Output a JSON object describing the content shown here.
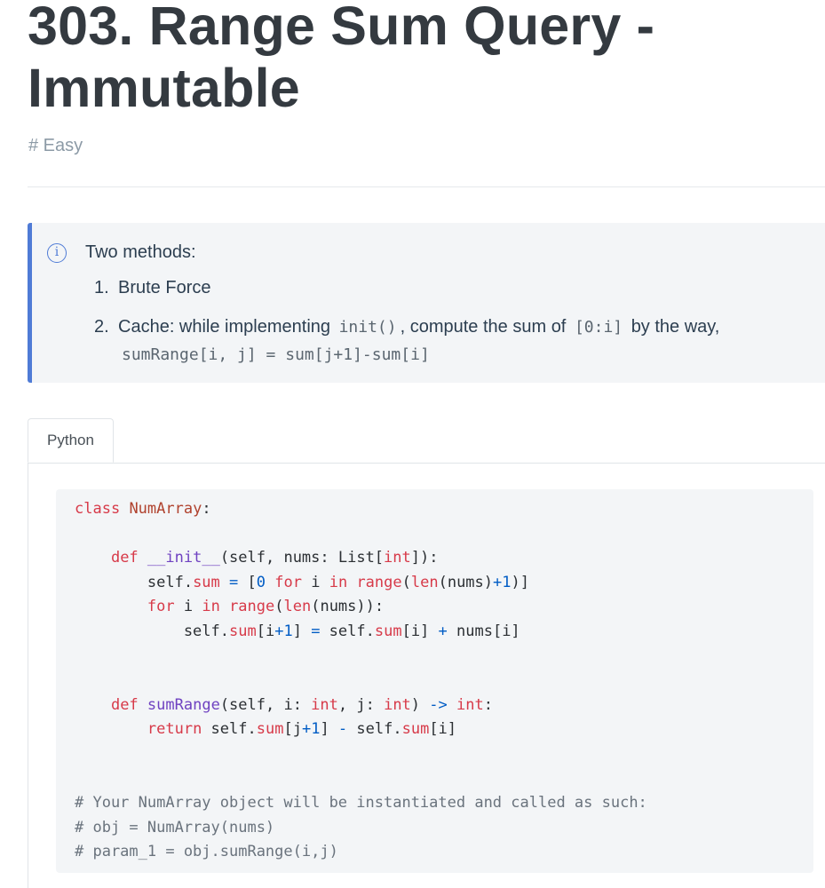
{
  "title": "303. Range Sum Query - Immutable",
  "tag": "# Easy",
  "info": {
    "heading": "Two methods:",
    "items": [
      {
        "num": "1.",
        "text": "Brute Force"
      },
      {
        "num": "2.",
        "text_a": "Cache: while implementing",
        "code_a": "init()",
        "text_b": ", compute the sum of",
        "code_b": "[0:i]",
        "text_c": "by the way,",
        "code_c": "sumRange[i, j] = sum[j+1]-sum[i]"
      }
    ]
  },
  "tabs": [
    {
      "label": "Python",
      "active": true
    }
  ],
  "code": {
    "language": "python",
    "lines": [
      "class NumArray:",
      "",
      "    def __init__(self, nums: List[int]):",
      "        self.sum = [0 for i in range(len(nums)+1)]",
      "        for i in range(len(nums)):",
      "            self.sum[i+1] = self.sum[i] + nums[i]",
      "",
      "",
      "    def sumRange(self, i: int, j: int) -> int:",
      "        return self.sum[j+1] - self.sum[i]",
      "",
      "",
      "# Your NumArray object will be instantiated and called as such:",
      "# obj = NumArray(nums)",
      "# param_1 = obj.sumRange(i,j)"
    ]
  },
  "colors": {
    "accent": "#4f7bd6",
    "keyword": "#d73a49",
    "function": "#6f42c1",
    "class_name": "#b0422e",
    "operator": "#005cc5",
    "comment": "#6a737d"
  }
}
